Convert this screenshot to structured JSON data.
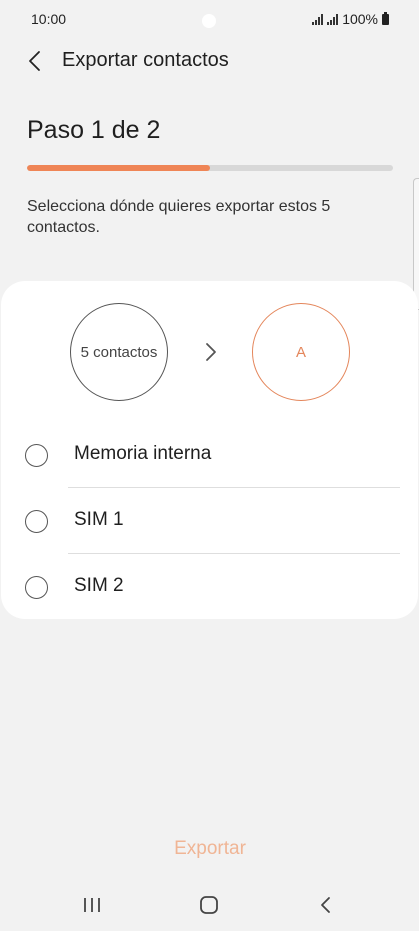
{
  "status_bar": {
    "time": "10:00",
    "battery_text": "100%",
    "icons": [
      "signal-icon",
      "signal-icon",
      "battery-icon"
    ]
  },
  "header": {
    "title": "Exportar contactos",
    "back_icon": "chevron-left-icon"
  },
  "step": {
    "title": "Paso 1 de 2",
    "progress": 0.5,
    "accent_color": "#ef8556"
  },
  "instruction": "Selecciona dónde quieres exportar estos 5 contactos.",
  "flow": {
    "source_label": "5 contactos",
    "destination_label": "A",
    "arrow_icon": "chevron-right-icon"
  },
  "options": [
    {
      "label": "Memoria interna",
      "selected": false
    },
    {
      "label": "SIM 1",
      "selected": false
    },
    {
      "label": "SIM 2",
      "selected": false
    }
  ],
  "footer": {
    "export_label": "Exportar",
    "export_color": "#f0b595"
  },
  "nav_bar": {
    "icons": [
      "recent-apps-icon",
      "home-icon",
      "back-icon"
    ]
  }
}
